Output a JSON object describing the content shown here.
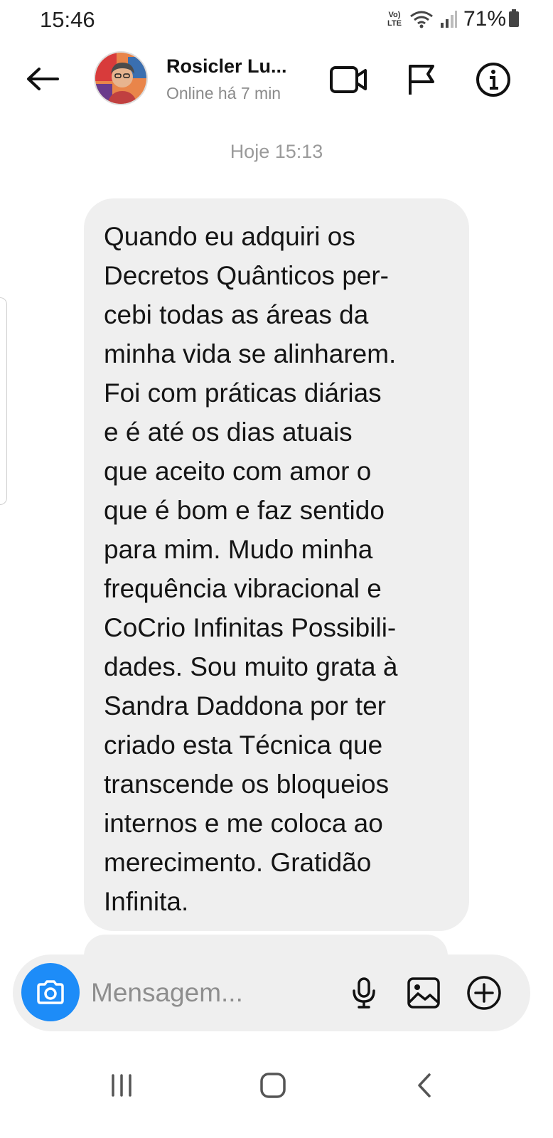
{
  "status_bar": {
    "time": "15:46",
    "volte_line1": "Vo)",
    "volte_line2": "LTE",
    "battery": "71%"
  },
  "header": {
    "contact_name": "Rosicler Lu...",
    "contact_status": "Online há 7 min",
    "icons": [
      "back-arrow-icon",
      "video-call-icon",
      "flag-icon",
      "info-icon"
    ]
  },
  "conversation": {
    "timestamp": "Hoje 15:13",
    "messages": [
      {
        "text": "Quando eu adquiri os\nDecretos Quânticos per-\ncebi todas as áreas da\nminha vida se alinharem.\nFoi com práticas diárias\ne é até os dias atuais\nque aceito com amor o\nque é bom e faz sentido\npara mim. Mudo minha\nfrequência vibracional e\nCoCrio Infinitas Possibili-\ndades. Sou muito grata à\nSandra Daddona por ter\ncriado esta Técnica que\ntranscende os bloqueios\ninternos e me coloca ao\nmerecimento. Gratidão\nInfinita."
      }
    ]
  },
  "composer": {
    "placeholder": "Mensagem...",
    "camera_color": "#1d8cf8",
    "icons": [
      "camera-icon",
      "microphone-icon",
      "gallery-icon",
      "plus-icon"
    ]
  },
  "navbar": {
    "icons": [
      "recent-apps-icon",
      "home-icon",
      "back-icon"
    ]
  }
}
